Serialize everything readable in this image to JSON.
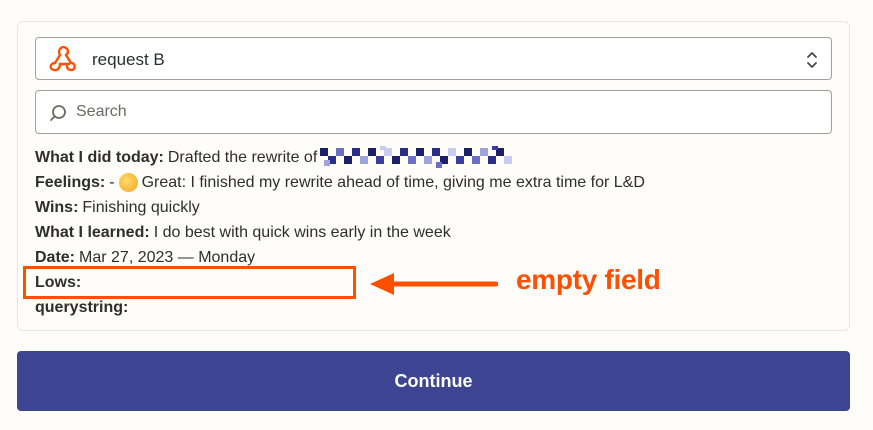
{
  "selector": {
    "value": "request B",
    "icon": "webhook-icon",
    "accent": "#ff4f00"
  },
  "search": {
    "placeholder": "Search"
  },
  "fields": [
    {
      "key": "What I did today:",
      "value": "Drafted the rewrite of"
    },
    {
      "key": "Feelings:",
      "value_prefix": "- ",
      "value": "Great: I finished my rewrite ahead of time, giving me extra time for L&D",
      "emoji": "partying-face-emoji"
    },
    {
      "key": "Wins:",
      "value": "Finishing quickly"
    },
    {
      "key": "What I learned:",
      "value": "I do best with quick wins early in the week"
    },
    {
      "key": "Date:",
      "value": "Mar 27, 2023 — Monday"
    },
    {
      "key": "Lows:",
      "value": ""
    },
    {
      "key": "querystring:",
      "value": ""
    }
  ],
  "annotation": {
    "text": "empty field",
    "color": "#ff4f00"
  },
  "continue_button": {
    "label": "Continue",
    "color": "#3d4592"
  }
}
